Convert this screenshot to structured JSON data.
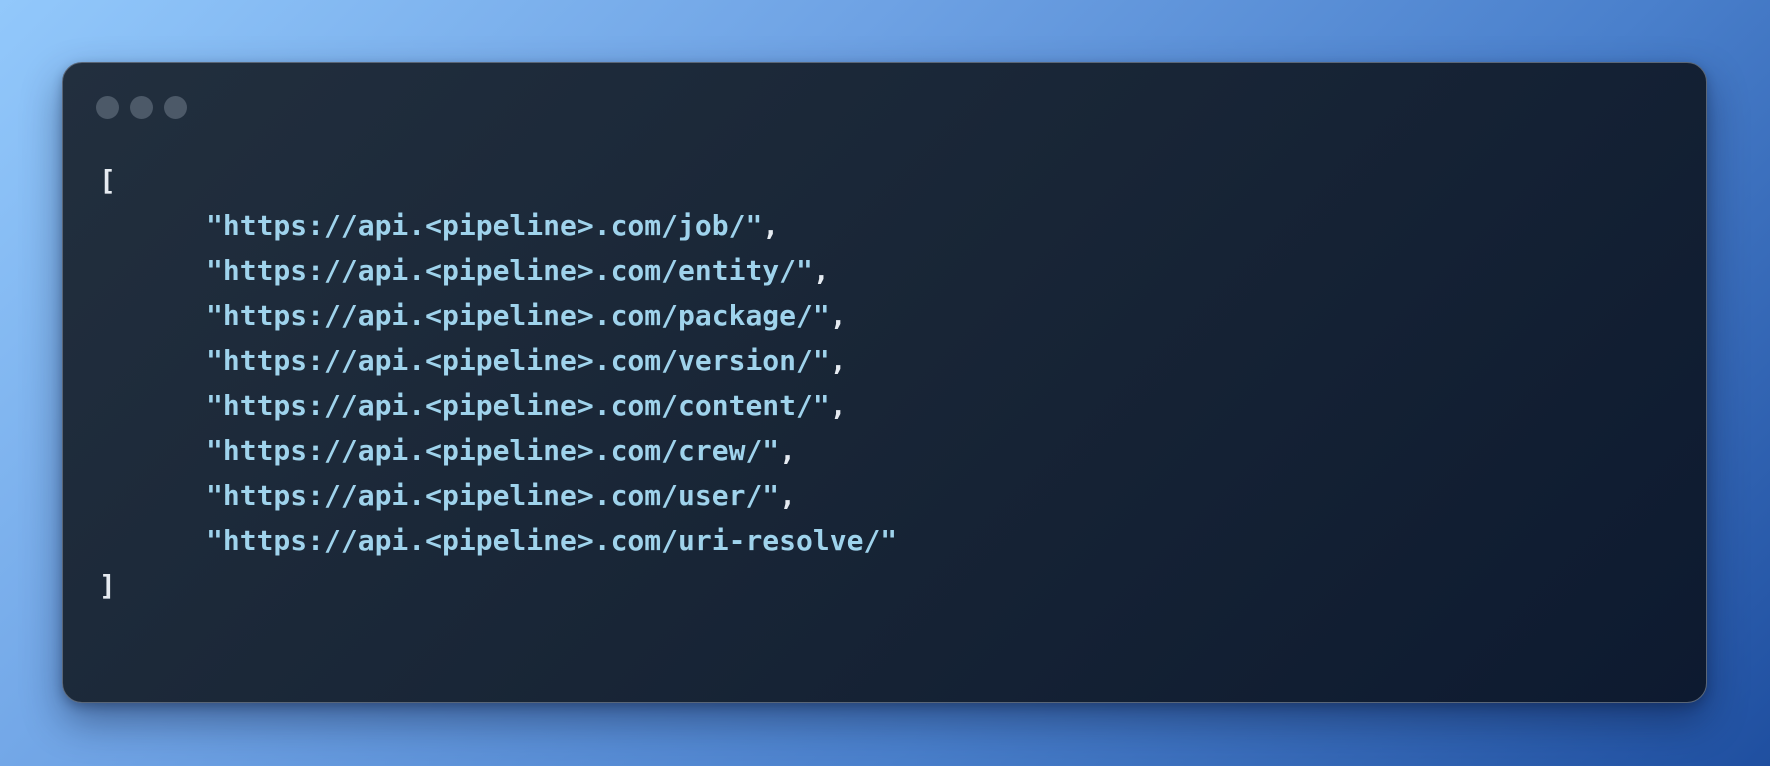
{
  "window": {
    "controls": [
      "window-dot-1",
      "window-dot-2",
      "window-dot-3"
    ]
  },
  "code": {
    "open_bracket": "[",
    "close_bracket": "]",
    "lines": [
      {
        "value": "\"https://api.<pipeline>.com/job/\"",
        "trail": ","
      },
      {
        "value": "\"https://api.<pipeline>.com/entity/\"",
        "trail": ","
      },
      {
        "value": "\"https://api.<pipeline>.com/package/\"",
        "trail": ","
      },
      {
        "value": "\"https://api.<pipeline>.com/version/\"",
        "trail": ","
      },
      {
        "value": "\"https://api.<pipeline>.com/content/\"",
        "trail": ","
      },
      {
        "value": "\"https://api.<pipeline>.com/crew/\"",
        "trail": ","
      },
      {
        "value": "\"https://api.<pipeline>.com/user/\"",
        "trail": ","
      },
      {
        "value": "\"https://api.<pipeline>.com/uri-resolve/\"",
        "trail": ""
      }
    ]
  },
  "colors": {
    "string": "#9fd3ec",
    "punctuation": "#e6ebf1",
    "window_dot": "#4c5968"
  }
}
